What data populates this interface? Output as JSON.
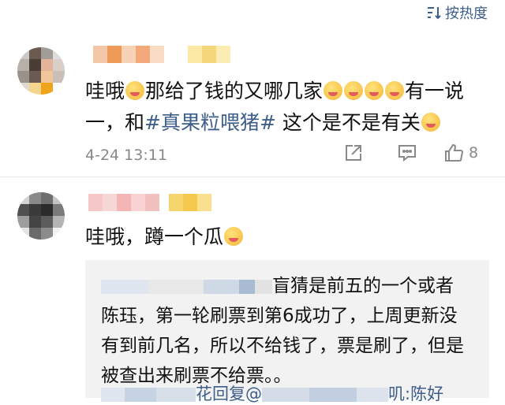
{
  "sort_label": "按热度",
  "comments": [
    {
      "text_parts": [
        "哇哦",
        "那给了钱的又哪几家",
        "有一说一，和",
        "#真果粒喂猪#",
        " 这个是不是有关"
      ],
      "timestamp": "4-24 13:11",
      "likes": "8"
    },
    {
      "text_parts": [
        "哇哦，蹲一个瓜"
      ],
      "reply": {
        "line1": "盲猜是前五的一个或者",
        "line2": "陈珏，第一轮刷票到第6成功了，上周更新没",
        "line3": "有到前几名，所以不给钱了，票是刷了，但是",
        "line4": "被查出来刷票不给票。。",
        "footer_a": "花回复@",
        "footer_b": "叽:陈好"
      }
    }
  ],
  "colors": {
    "link": "#3d5e8a",
    "meta": "#888888",
    "reply_bg": "#f2f2f2"
  },
  "icons": [
    "sort-icon",
    "share-icon",
    "comment-icon",
    "like-icon"
  ]
}
